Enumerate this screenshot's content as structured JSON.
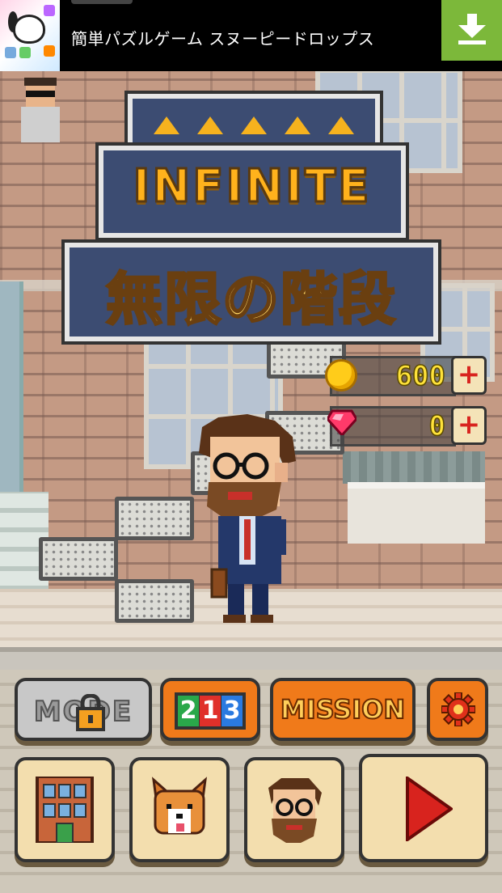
{
  "ad": {
    "title": "簡単パズルゲーム スヌーピードロップス",
    "download_icon": "download-arrow-icon",
    "app_icon": "snoopy-drops-app-icon"
  },
  "logo": {
    "title_en": "INFINITE",
    "title_jp": "無限の階段"
  },
  "currency": {
    "coins": "600",
    "gems": "0",
    "add_label": "+"
  },
  "menu": {
    "mode_label": "MODE",
    "ranking_digits": [
      "2",
      "1",
      "3"
    ],
    "mission_label": "MISSION",
    "settings_icon": "gear-icon",
    "building_icon": "building-icon",
    "pet_icon": "corgi-icon",
    "character_icon": "character-face-icon",
    "play_icon": "play-triangle-icon"
  },
  "colors": {
    "ad_green": "#7cb83a",
    "logo_navy": "#3c4c72",
    "logo_gold": "#ffb21c",
    "button_orange": "#f07a1a",
    "button_tan": "#f3deae",
    "play_red": "#d8231e",
    "coin_text": "#ffe23a"
  }
}
